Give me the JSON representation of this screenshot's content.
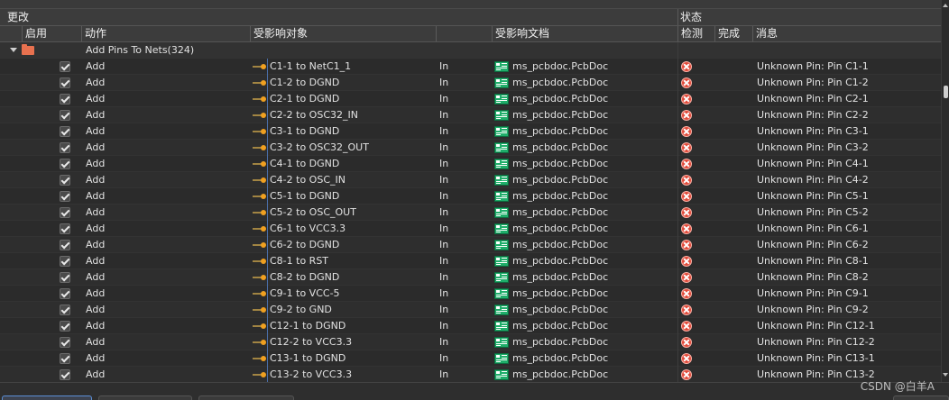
{
  "group_headers": {
    "changes": "更改",
    "status": "状态"
  },
  "columns": {
    "enable": "启用",
    "action": "动作",
    "affected_object": "受影响对象",
    "affected_document": "受影响文档",
    "check": "检测",
    "done": "完成",
    "message": "消息"
  },
  "group_row": {
    "label": "Add Pins To Nets(324)"
  },
  "rows": [
    {
      "action": "Add",
      "object": "C1-1 to NetC1_1",
      "dir": "In",
      "doc": "ms_pcbdoc.PcbDoc",
      "message": "Unknown Pin: Pin C1-1"
    },
    {
      "action": "Add",
      "object": "C1-2 to DGND",
      "dir": "In",
      "doc": "ms_pcbdoc.PcbDoc",
      "message": "Unknown Pin: Pin C1-2"
    },
    {
      "action": "Add",
      "object": "C2-1 to DGND",
      "dir": "In",
      "doc": "ms_pcbdoc.PcbDoc",
      "message": "Unknown Pin: Pin C2-1"
    },
    {
      "action": "Add",
      "object": "C2-2 to OSC32_IN",
      "dir": "In",
      "doc": "ms_pcbdoc.PcbDoc",
      "message": "Unknown Pin: Pin C2-2"
    },
    {
      "action": "Add",
      "object": "C3-1 to DGND",
      "dir": "In",
      "doc": "ms_pcbdoc.PcbDoc",
      "message": "Unknown Pin: Pin C3-1"
    },
    {
      "action": "Add",
      "object": "C3-2 to OSC32_OUT",
      "dir": "In",
      "doc": "ms_pcbdoc.PcbDoc",
      "message": "Unknown Pin: Pin C3-2"
    },
    {
      "action": "Add",
      "object": "C4-1 to DGND",
      "dir": "In",
      "doc": "ms_pcbdoc.PcbDoc",
      "message": "Unknown Pin: Pin C4-1"
    },
    {
      "action": "Add",
      "object": "C4-2 to OSC_IN",
      "dir": "In",
      "doc": "ms_pcbdoc.PcbDoc",
      "message": "Unknown Pin: Pin C4-2"
    },
    {
      "action": "Add",
      "object": "C5-1 to DGND",
      "dir": "In",
      "doc": "ms_pcbdoc.PcbDoc",
      "message": "Unknown Pin: Pin C5-1"
    },
    {
      "action": "Add",
      "object": "C5-2 to OSC_OUT",
      "dir": "In",
      "doc": "ms_pcbdoc.PcbDoc",
      "message": "Unknown Pin: Pin C5-2"
    },
    {
      "action": "Add",
      "object": "C6-1 to VCC3.3",
      "dir": "In",
      "doc": "ms_pcbdoc.PcbDoc",
      "message": "Unknown Pin: Pin C6-1"
    },
    {
      "action": "Add",
      "object": "C6-2 to DGND",
      "dir": "In",
      "doc": "ms_pcbdoc.PcbDoc",
      "message": "Unknown Pin: Pin C6-2"
    },
    {
      "action": "Add",
      "object": "C8-1 to RST",
      "dir": "In",
      "doc": "ms_pcbdoc.PcbDoc",
      "message": "Unknown Pin: Pin C8-1"
    },
    {
      "action": "Add",
      "object": "C8-2 to DGND",
      "dir": "In",
      "doc": "ms_pcbdoc.PcbDoc",
      "message": "Unknown Pin: Pin C8-2"
    },
    {
      "action": "Add",
      "object": "C9-1 to VCC-5",
      "dir": "In",
      "doc": "ms_pcbdoc.PcbDoc",
      "message": "Unknown Pin: Pin C9-1"
    },
    {
      "action": "Add",
      "object": "C9-2 to GND",
      "dir": "In",
      "doc": "ms_pcbdoc.PcbDoc",
      "message": "Unknown Pin: Pin C9-2"
    },
    {
      "action": "Add",
      "object": "C12-1 to DGND",
      "dir": "In",
      "doc": "ms_pcbdoc.PcbDoc",
      "message": "Unknown Pin: Pin C12-1"
    },
    {
      "action": "Add",
      "object": "C12-2 to VCC3.3",
      "dir": "In",
      "doc": "ms_pcbdoc.PcbDoc",
      "message": "Unknown Pin: Pin C12-2"
    },
    {
      "action": "Add",
      "object": "C13-1 to DGND",
      "dir": "In",
      "doc": "ms_pcbdoc.PcbDoc",
      "message": "Unknown Pin: Pin C13-1"
    },
    {
      "action": "Add",
      "object": "C13-2 to VCC3.3",
      "dir": "In",
      "doc": "ms_pcbdoc.PcbDoc",
      "message": "Unknown Pin: Pin C13-2"
    }
  ],
  "watermark": "CSDN @白羊A",
  "colors": {
    "background": "#2b2b2b",
    "error": "#e04a3a",
    "pin_orange": "#f0a020",
    "doc_green": "#1fae6a",
    "folder": "#e8714f"
  }
}
